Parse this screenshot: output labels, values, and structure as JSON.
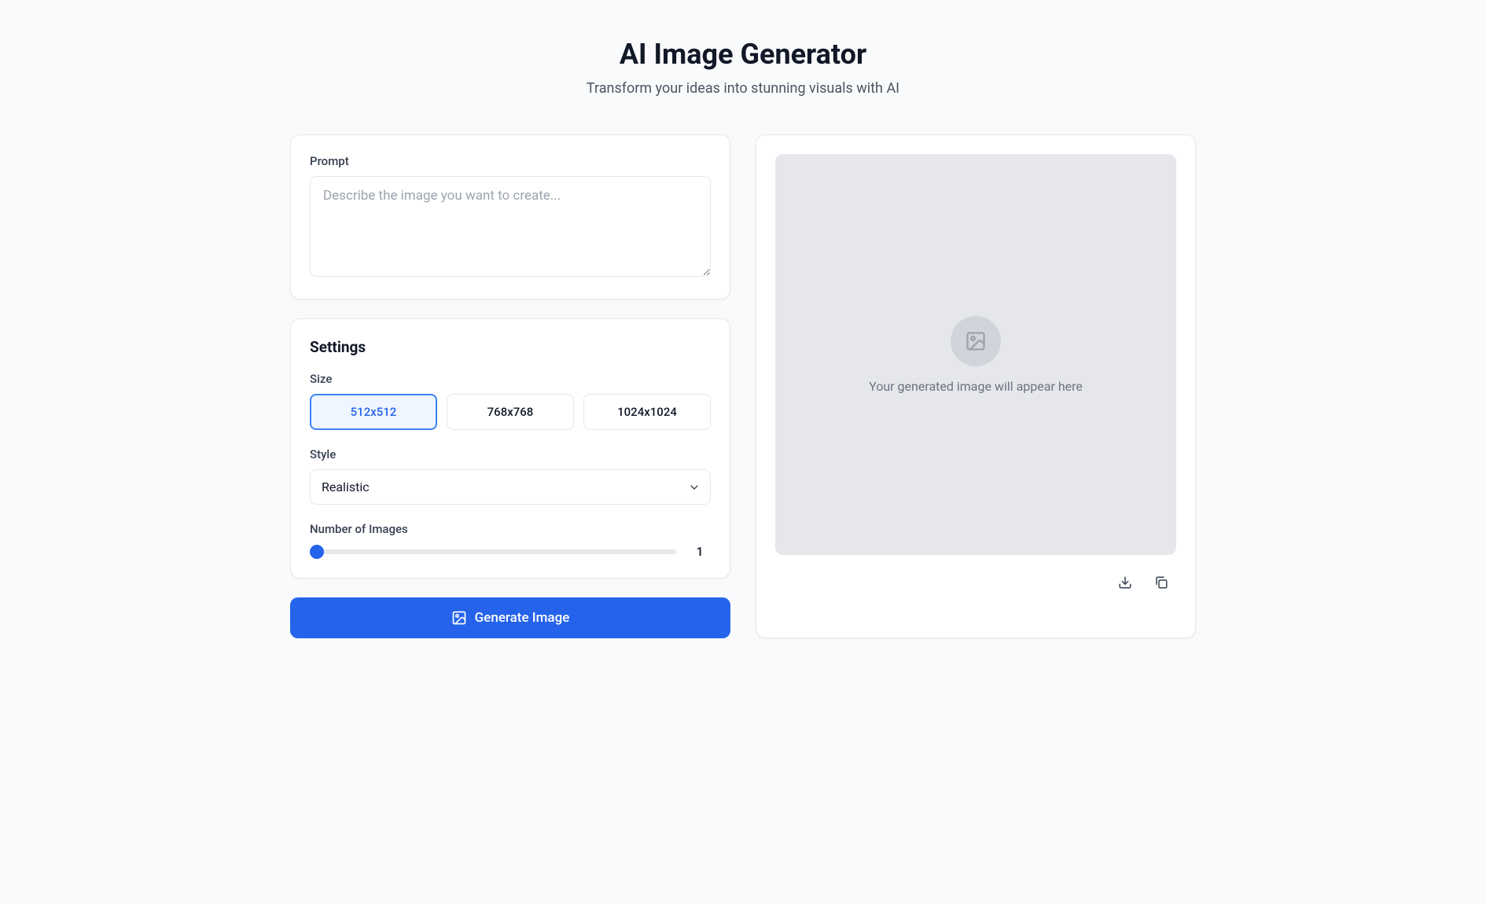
{
  "header": {
    "title": "AI Image Generator",
    "subtitle": "Transform your ideas into stunning visuals with AI"
  },
  "prompt": {
    "label": "Prompt",
    "placeholder": "Describe the image you want to create...",
    "value": ""
  },
  "settings": {
    "heading": "Settings",
    "size": {
      "label": "Size",
      "options": [
        "512x512",
        "768x768",
        "1024x1024"
      ],
      "selected": "512x512"
    },
    "style": {
      "label": "Style",
      "selected": "Realistic"
    },
    "count": {
      "label": "Number of Images",
      "value": "1",
      "min": "1",
      "max": "4"
    }
  },
  "generate": {
    "label": "Generate Image"
  },
  "result": {
    "placeholder_text": "Your generated image will appear here"
  }
}
